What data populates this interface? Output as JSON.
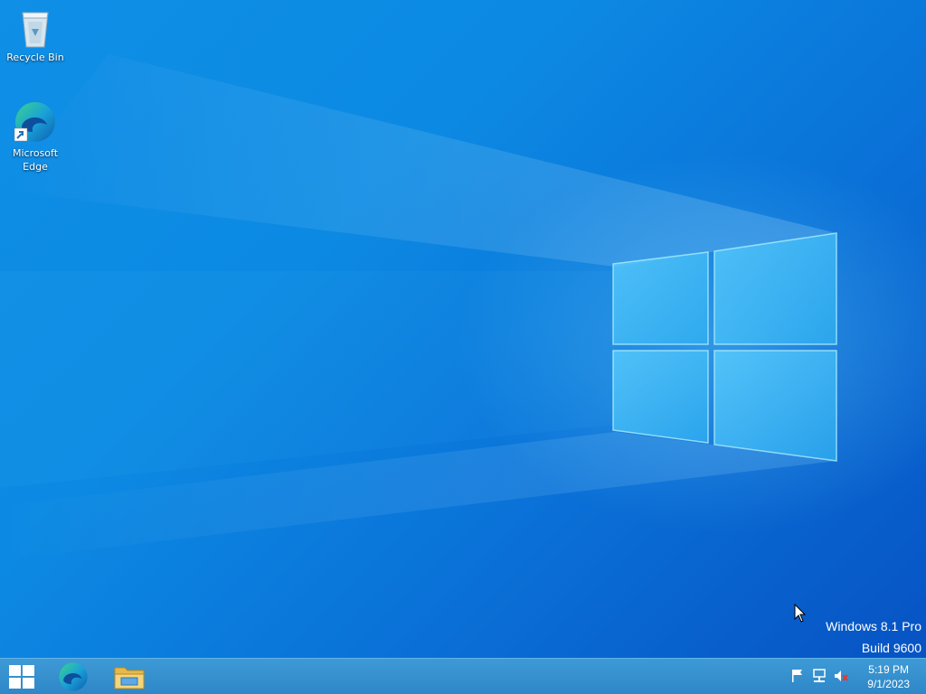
{
  "desktop": {
    "icons": [
      {
        "label_lines": [
          "Recycle Bin"
        ],
        "icon": "recycle-bin-icon"
      },
      {
        "label_lines": [
          "Microsoft",
          "Edge"
        ],
        "icon": "edge-icon"
      }
    ],
    "watermark": {
      "line1": "Windows 8.1 Pro",
      "line2": "Build 9600"
    }
  },
  "taskbar": {
    "start_icon": "windows-logo-icon",
    "pinned": [
      {
        "name": "Microsoft Edge",
        "icon": "edge-icon"
      },
      {
        "name": "File Explorer",
        "icon": "file-explorer-icon"
      }
    ],
    "tray": {
      "icons": [
        "action-center-flag-icon",
        "network-icon",
        "volume-muted-icon"
      ],
      "time": "5:19 PM",
      "date": "9/1/2023"
    }
  },
  "colors": {
    "wallpaper_main": "#0c8ae3",
    "wallpaper_dark": "#0753c4",
    "taskbar": "#3591cf",
    "logo_glow": "#7fe0ff"
  }
}
